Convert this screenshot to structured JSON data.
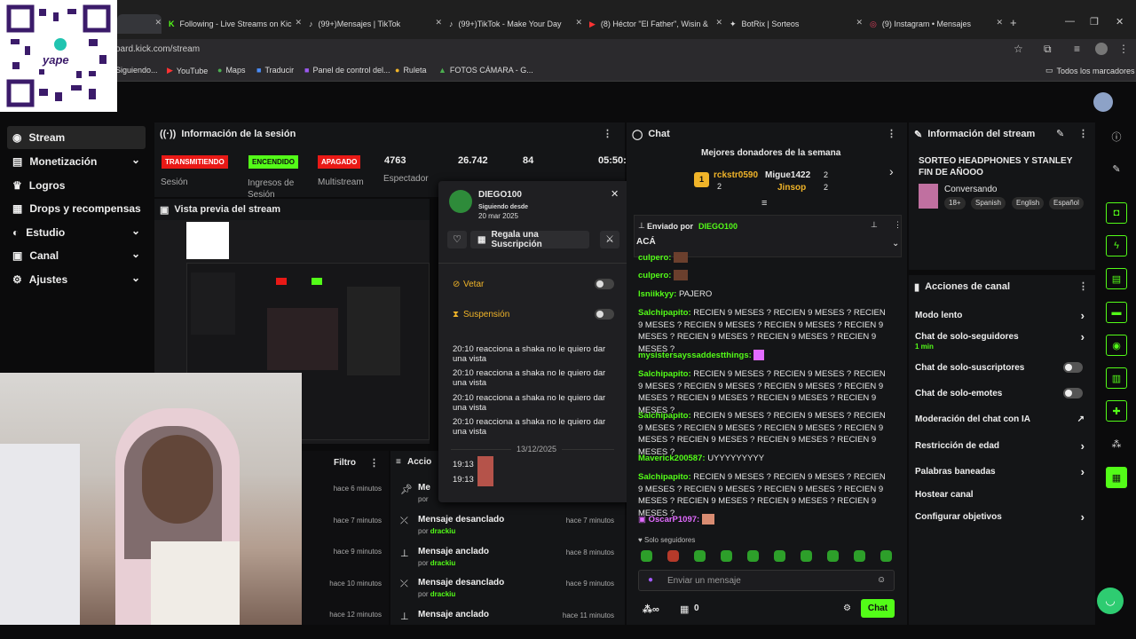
{
  "browser": {
    "tabs": [
      {
        "label": "Following - Live Streams on Kic"
      },
      {
        "label": "(99+)Mensajes | TikTok"
      },
      {
        "label": "(99+)TikTok - Make Your Day"
      },
      {
        "label": "(8) Héctor \"El Father\", Wisin &"
      },
      {
        "label": "BotRix | Sorteos"
      },
      {
        "label": "(9) Instagram • Mensajes"
      }
    ],
    "url": "oard.kick.com/stream",
    "bookmarks": [
      "Siguiendo...",
      "YouTube",
      "Maps",
      "Traducir",
      "Panel de control del...",
      "Ruleta",
      "FOTOS CÁMARA - G..."
    ],
    "all_bookmarks": "Todos los marcadores"
  },
  "overlay": {
    "qr_brand": "yape"
  },
  "nav": {
    "items": [
      {
        "label": "Stream",
        "icon": "stream-icon"
      },
      {
        "label": "Monetización",
        "icon": "money-icon"
      },
      {
        "label": "Logros",
        "icon": "trophy-icon"
      },
      {
        "label": "Drops y recompensas",
        "icon": "gift-icon"
      },
      {
        "label": "Estudio",
        "icon": "studio-icon"
      },
      {
        "label": "Canal",
        "icon": "channel-icon"
      },
      {
        "label": "Ajustes",
        "icon": "gear-icon"
      }
    ]
  },
  "session": {
    "title": "Información de la sesión",
    "badges": [
      "TRANSMITIENDO",
      "ENCENDIDO",
      "APAGADO"
    ],
    "labels": [
      "Sesión",
      "Ingresos de Sesión",
      "Multistream",
      "Espectador"
    ],
    "stats": [
      "4763",
      "26.742",
      "84",
      "05:50:"
    ]
  },
  "preview": {
    "title": "Vista previa del stream"
  },
  "filter": {
    "label": "Filtro",
    "times": [
      "hace 6 minutos",
      "hace 7 minutos",
      "hace 9 minutos",
      "hace 10 minutos",
      "hace 12 minutos"
    ]
  },
  "actions_log": {
    "title": "Accio",
    "rows": [
      {
        "title": "Me",
        "by": "por",
        "user": "",
        "time": ""
      },
      {
        "title": "Mensaje desanclado",
        "by": "por",
        "user": "drackiu",
        "time": "hace 7 minutos"
      },
      {
        "title": "Mensaje anclado",
        "by": "por",
        "user": "drackiu",
        "time": "hace 8 minutos"
      },
      {
        "title": "Mensaje desanclado",
        "by": "por",
        "user": "drackiu",
        "time": "hace 9 minutos"
      },
      {
        "title": "Mensaje anclado",
        "by": "",
        "user": "",
        "time": "hace 11 minutos"
      }
    ]
  },
  "popup": {
    "username": "DIEGO100",
    "following_label": "Siguiendo desde",
    "following_date": "20 mar 2025",
    "gift_label": "Regala una Suscripción",
    "veto": "Vetar",
    "suspension": "Suspensión",
    "messages": [
      "20:10 reacciona a shaka no le quiero dar una vista",
      "20:10 reacciona a shaka no le quiero dar una vista",
      "20:10 reacciona a shaka no le quiero dar una vista",
      "20:10 reacciona a shaka no le quiero dar una vista"
    ],
    "date_sep": "13/12/2025",
    "late_times": [
      "19:13",
      "19:13"
    ]
  },
  "chat": {
    "title": "Chat",
    "donors_title": "Mejores donadores de la semana",
    "donors": [
      {
        "rank": "1",
        "name": "rckstr0590",
        "count": "2"
      },
      {
        "name": "Migue1422",
        "count": "2"
      },
      {
        "name": "Jinsop",
        "count": "2"
      }
    ],
    "pinned": {
      "sent_by": "Enviado por",
      "user": "DIEGO100",
      "text": "ACÁ"
    },
    "lines": [
      {
        "user": "culpero:",
        "text": ""
      },
      {
        "user": "culpero:",
        "text": ""
      },
      {
        "user": "lsniikkyy:",
        "text": "PAJERO"
      },
      {
        "user": "Salchipapito:",
        "text": "RECIEN 9 MESES ? RECIEN 9 MESES ? RECIEN 9 MESES ? RECIEN 9 MESES ? RECIEN 9 MESES ? RECIEN 9 MESES ? RECIEN 9 MESES ? RECIEN 9 MESES ? RECIEN 9 MESES ?"
      },
      {
        "user": "mysistersayssaddestthings:",
        "text": ""
      },
      {
        "user": "Salchipapito:",
        "text": "RECIEN 9 MESES ? RECIEN 9 MESES ? RECIEN 9 MESES ? RECIEN 9 MESES ? RECIEN 9 MESES ? RECIEN 9 MESES ? RECIEN 9 MESES ? RECIEN 9 MESES ? RECIEN 9 MESES ?"
      },
      {
        "user": "Salchipapito:",
        "text": "RECIEN 9 MESES ? RECIEN 9 MESES ? RECIEN 9 MESES ? RECIEN 9 MESES ? RECIEN 9 MESES ? RECIEN 9 MESES ? RECIEN 9 MESES ? RECIEN 9 MESES ? RECIEN 9 MESES ?"
      },
      {
        "user": "Maverick200587:",
        "text": "UYYYYYYYYY"
      },
      {
        "user": "Salchipapito:",
        "text": "RECIEN 9 MESES ? RECIEN 9 MESES ? RECIEN 9 MESES ? RECIEN 9 MESES ? RECIEN 9 MESES ? RECIEN 9 MESES ? RECIEN 9 MESES ? RECIEN 9 MESES ? RECIEN 9 MESES ?"
      },
      {
        "user": "OscarP1097:",
        "text": ""
      }
    ],
    "followers_only": "Solo seguidores",
    "input_placeholder": "Enviar un mensaje",
    "count": "0",
    "send_label": "Chat"
  },
  "stream_info": {
    "title": "Información del stream",
    "stream_title": "SORTEO HEADPHONES Y STANLEY FIN DE AÑOOO",
    "category": "Conversando",
    "tags": [
      "18+",
      "Spanish",
      "English",
      "Español"
    ]
  },
  "channel_actions": {
    "title": "Acciones de canal",
    "items": [
      {
        "label": "Modo lento"
      },
      {
        "label": "Chat de solo-seguidores",
        "sub": "1 min"
      },
      {
        "label": "Chat de solo-suscriptores"
      },
      {
        "label": "Chat de solo-emotes"
      },
      {
        "label": "Moderación del chat con IA"
      },
      {
        "label": "Restricción de edad"
      },
      {
        "label": "Palabras baneadas"
      },
      {
        "label": "Hostear canal"
      },
      {
        "label": "Configurar objetivos"
      }
    ]
  },
  "colors": {
    "accent": "#53fc18",
    "live_red": "#e91916",
    "bg": "#0b0b0c",
    "panel": "#141517"
  }
}
